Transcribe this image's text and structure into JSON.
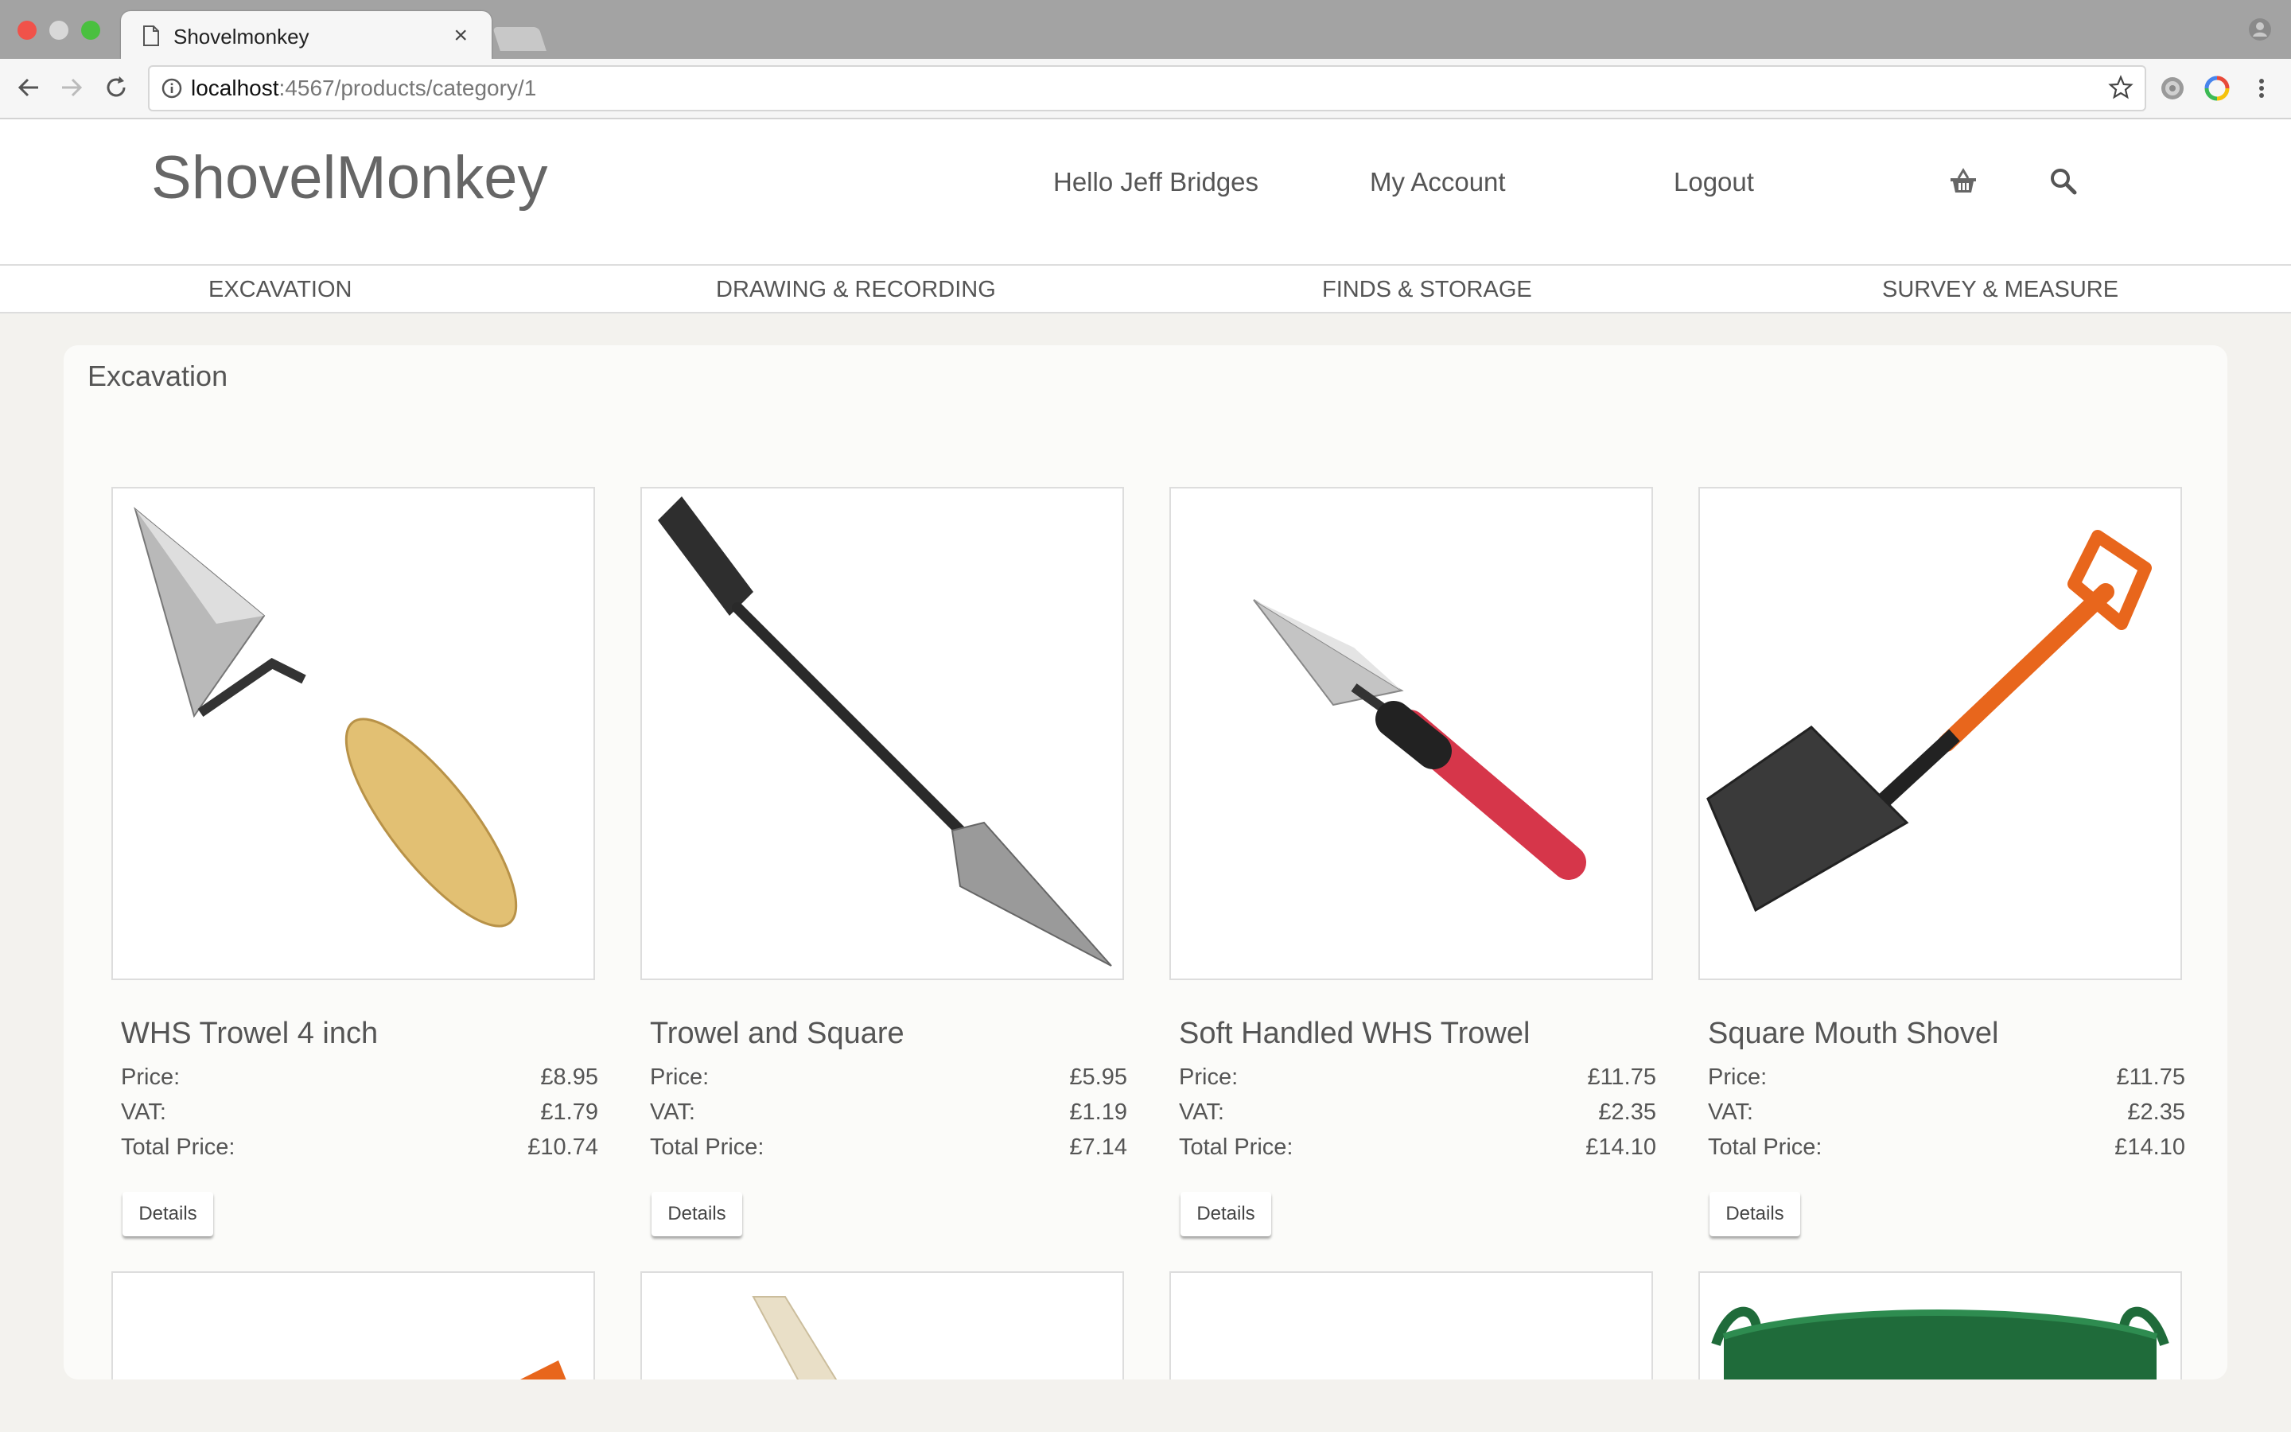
{
  "browser": {
    "tab_title": "Shovelmonkey",
    "tab_close": "×",
    "url_host": "localhost",
    "url_rest": ":4567/products/category/1"
  },
  "header": {
    "brand": "ShovelMonkey",
    "greeting": "Hello Jeff Bridges",
    "my_account": "My Account",
    "logout": "Logout"
  },
  "categories": [
    "EXCAVATION",
    "DRAWING & RECORDING",
    "FINDS & STORAGE",
    "SURVEY & MEASURE"
  ],
  "page": {
    "title": "Excavation"
  },
  "labels": {
    "price": "Price:",
    "vat": "VAT:",
    "total": "Total Price:",
    "details": "Details"
  },
  "products": [
    {
      "name": "WHS Trowel 4 inch",
      "price": "£8.95",
      "vat": "£1.79",
      "total": "£10.74"
    },
    {
      "name": "Trowel and Square",
      "price": "£5.95",
      "vat": "£1.19",
      "total": "£7.14"
    },
    {
      "name": "Soft Handled WHS Trowel",
      "price": "£11.75",
      "vat": "£2.35",
      "total": "£14.10"
    },
    {
      "name": "Square Mouth Shovel",
      "price": "£11.75",
      "vat": "£2.35",
      "total": "£14.10"
    }
  ],
  "colors": {
    "accent_orange": "#e8661c",
    "handle_red": "#d6364a",
    "bucket_green": "#1f6b3a"
  }
}
